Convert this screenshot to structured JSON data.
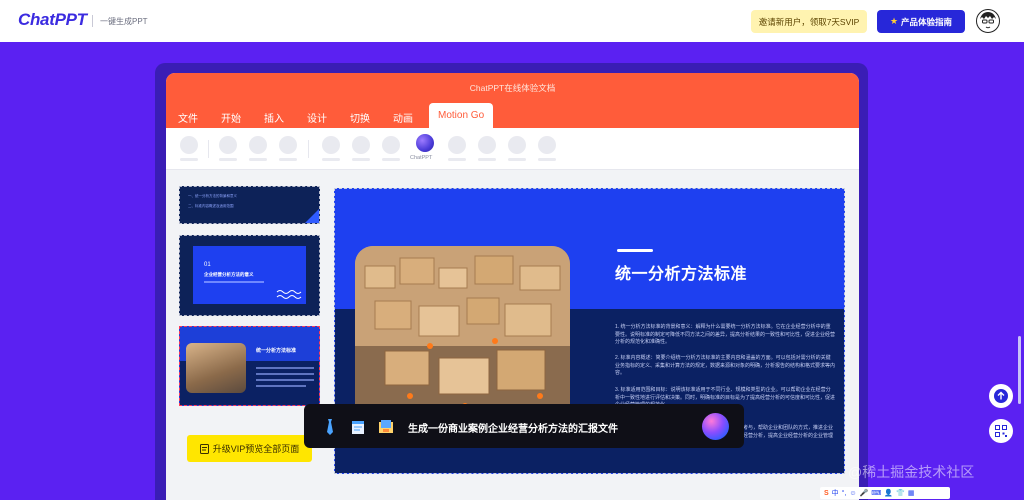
{
  "header": {
    "logo": "ChatPPT",
    "tagline": "一键生成PPT",
    "invite_btn": "邀请新用户，领取7天SVIP",
    "guide_btn": "产品体验指南",
    "guide_icon": "star-icon"
  },
  "editor": {
    "doc_title": "ChatPPT在线体验文档",
    "tabs": [
      "文件",
      "开始",
      "插入",
      "设计",
      "切换",
      "动画",
      "Motion Go"
    ],
    "active_tab": "Motion Go",
    "motion_label": "ChatPPT"
  },
  "slide": {
    "title": "统一分析方法标准",
    "paragraphs": [
      "1. 统一分析方法标准的背景和意义：解释为什么需要统一分析方法标准。它在企业经营分析中的重要性。说明标准的制定可降低不同方法之间的差异，提高分析结果的一致性和可比性，促进企业经营分析的规范化和准确性。",
      "2. 标准内容概述：简要介绍统一分析方法标准的主要内容和涵盖的方面。可以包括对需分析的关键业务指标的定义、采集和计算方法的规定，数据来源和对象的明确，分析报告的结构和格式要求等内容。",
      "3. 标准适用范围和目标：说明该标准适用于不同行业、规模和类型的企业。可以帮助企业在经营分析中一致性地进行评估和决策。同时，明确标准的目标是为了提高经营分析的可信度和可比性，促进企业经营管理的规范化。",
      "提供标准的参考与，帮助企业和团队的方式，推进企业和领域的企业经营分析，提高企业经营分析的企业管理和企业要求。"
    ]
  },
  "thumbnails": {
    "t1_lines": [
      "一、统一分析方法的背景和意义",
      "二、标准内容概述及适用范围"
    ],
    "t2_num": "01",
    "t2_title": "企业经营分析方法的意义",
    "t3_title": "统一分析方法标准"
  },
  "vip_btn": "升级VIP预览全部页面",
  "prompt": "生成一份商业案例企业经营分析方法的汇报文件",
  "watermark": "@稀土掘金技术社区",
  "ime": [
    "中",
    "°,",
    "☺",
    "🎤",
    "⌨",
    "👤",
    "👕",
    "▦"
  ],
  "colors": {
    "brand_purple": "#5b21f2",
    "accent_orange": "#ff5c3a",
    "slide_blue": "#1e40f0",
    "slide_navy": "#0b2163",
    "vip_yellow": "#ffe600"
  }
}
